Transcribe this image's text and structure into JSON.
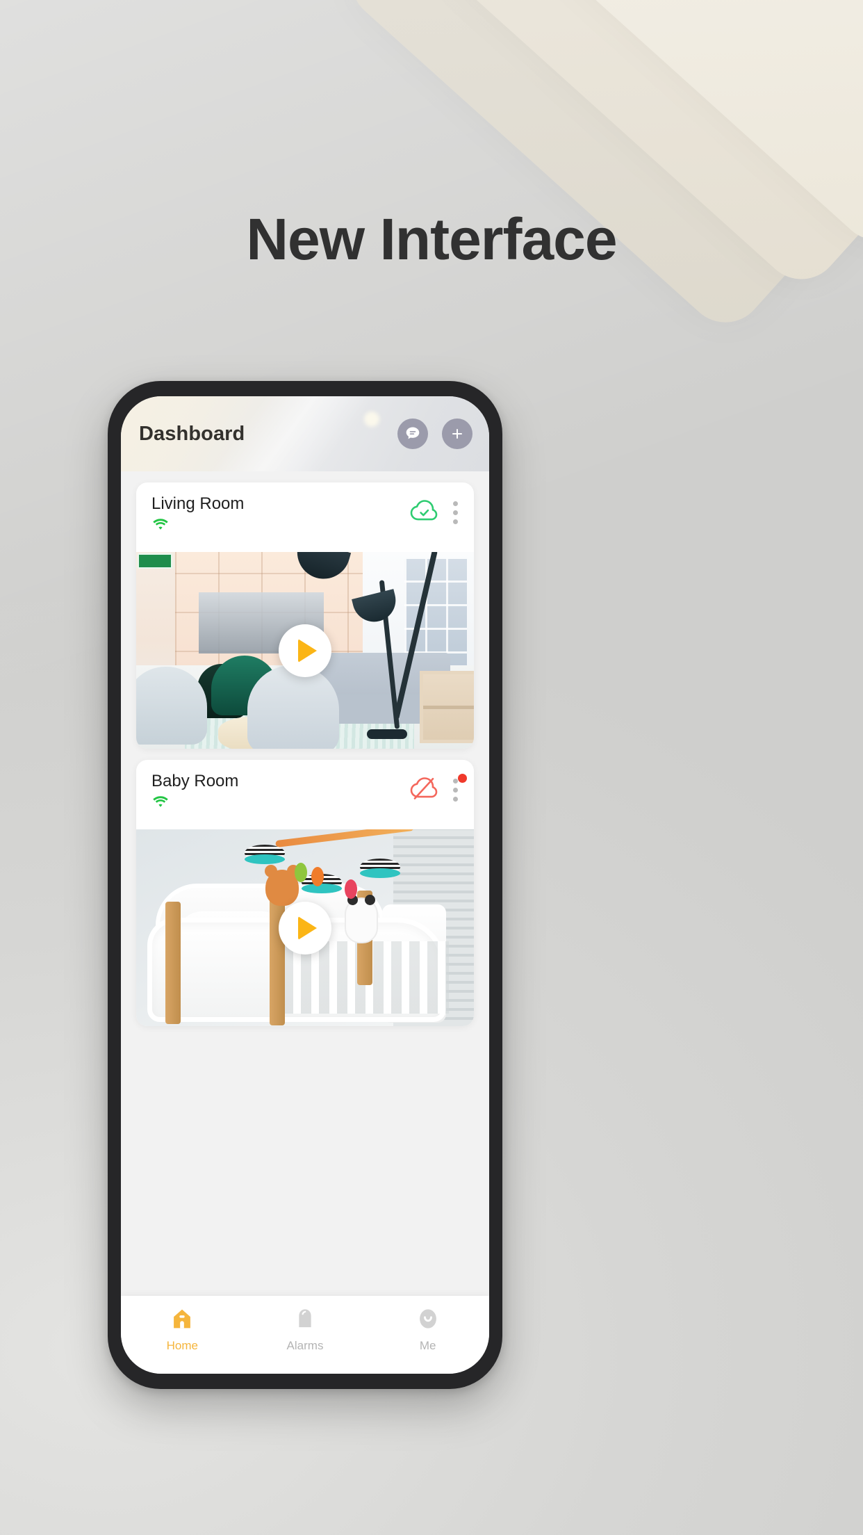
{
  "headline": "New Interface",
  "theme": {
    "accent_yellow": "#f5b53c",
    "play_yellow": "#fbb516",
    "online_green": "#2ecc71",
    "offline_red": "#f0392b",
    "header_icon_bg": "#9b9bab",
    "page_bg": "#d9d9d7",
    "phone_frame": "#262628"
  },
  "app": {
    "header": {
      "title": "Dashboard",
      "actions": [
        {
          "name": "message-icon",
          "label": "Messages"
        },
        {
          "name": "plus-icon",
          "label": "Add device"
        }
      ]
    },
    "cameras": [
      {
        "title": "Living Room",
        "wifi_icon": "wifi-icon",
        "wifi_status": "connected",
        "cloud_icon": "cloud-check-icon",
        "cloud_status": "cloud storage on",
        "cloud_color": "#2ecc71",
        "menu_icon": "more-vertical-icon",
        "has_notification_badge": false,
        "play_icon": "play-icon",
        "scene": "living-room"
      },
      {
        "title": "Baby Room",
        "wifi_icon": "wifi-icon",
        "wifi_status": "connected",
        "cloud_icon": "cloud-off-icon",
        "cloud_status": "cloud storage off",
        "cloud_color": "#f0392b",
        "menu_icon": "more-vertical-icon",
        "has_notification_badge": true,
        "play_icon": "play-icon",
        "scene": "baby-room"
      }
    ],
    "bottom_nav": [
      {
        "label": "Home",
        "icon": "home-icon",
        "active": true
      },
      {
        "label": "Alarms",
        "icon": "bell-icon",
        "active": false
      },
      {
        "label": "Me",
        "icon": "user-icon",
        "active": false
      }
    ]
  }
}
